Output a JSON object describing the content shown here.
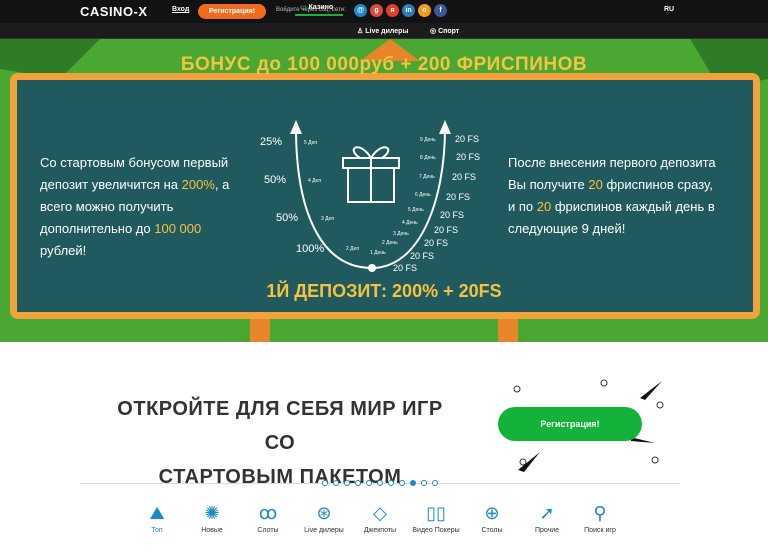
{
  "header": {
    "logo": "CASINO-X",
    "login": "Вход",
    "register": "Регистрация!",
    "social_label": "Войдите через соц. сети:",
    "social_icons": [
      "mail-ru-icon",
      "google-plus-icon",
      "odnoklassniki-icon",
      "linkedin-icon",
      "ok-icon",
      "facebook-icon"
    ],
    "lang": "RU"
  },
  "nav": {
    "items": [
      {
        "label": "Казино",
        "icon": "casino-icon"
      },
      {
        "label": "Live дилеры",
        "icon": "live-icon"
      },
      {
        "label": "Спорт",
        "icon": "sport-icon"
      }
    ]
  },
  "hero": {
    "title": "БОНУС до 100 000руб + 200 ФРИСПИНОВ",
    "left_parts": [
      "Со стартовым бонусом первый депозит увеличится на ",
      "200%",
      ", а всего можно получить дополнительно до ",
      "100 000",
      " рублей!"
    ],
    "right_parts": [
      "После внесения первого депозита Вы получите ",
      "20",
      " фриспинов сразу, и по ",
      "20",
      " фриспинов каждый день в следующие 9 дней!"
    ],
    "bottom_title": "1Й ДЕПОЗИТ: 200% + 20FS",
    "deposits": [
      {
        "pct": "25%",
        "label": "5 Деп"
      },
      {
        "pct": "50%",
        "label": "4 Деп"
      },
      {
        "pct": "50%",
        "label": "3 Деп"
      },
      {
        "pct": "100%",
        "label": "2 Деп"
      }
    ],
    "days": [
      {
        "label": "9 День",
        "fs": "20 FS"
      },
      {
        "label": "8 День",
        "fs": "20 FS"
      },
      {
        "label": "7 День",
        "fs": "20 FS"
      },
      {
        "label": "6 День",
        "fs": "20 FS"
      },
      {
        "label": "5 День",
        "fs": "20 FS"
      },
      {
        "label": "4 День",
        "fs": "20 FS"
      },
      {
        "label": "3 День",
        "fs": "20 FS"
      },
      {
        "label": "2 День",
        "fs": "20 FS"
      },
      {
        "label": "1 День",
        "fs": "20 FS"
      },
      {
        "label": "",
        "fs": "20 FS"
      }
    ]
  },
  "promo": {
    "line1": "ОТКРОЙТЕ ДЛЯ СЕБЯ МИР ИГР СО",
    "line2": "СТАРТОВЫМ ПАКЕТОМ БОНУСОВ!",
    "button": "Регистрация!",
    "active_slide": 8,
    "slides_total": 11
  },
  "categories": [
    {
      "label": "Топ",
      "icon": "mountain-icon",
      "active": true
    },
    {
      "label": "Новые",
      "icon": "sun-icon",
      "active": false
    },
    {
      "label": "Слоты",
      "icon": "cherries-icon",
      "active": false
    },
    {
      "label": "Live дилеры",
      "icon": "chips-icon",
      "active": false
    },
    {
      "label": "Джекпоты",
      "icon": "diamond-icon",
      "active": false
    },
    {
      "label": "Видео Покеры",
      "icon": "cards-icon",
      "active": false
    },
    {
      "label": "Столы",
      "icon": "roulette-icon",
      "active": false
    },
    {
      "label": "Прочие",
      "icon": "arrow-icon",
      "active": false
    },
    {
      "label": "Поиск игр",
      "icon": "search-icon",
      "active": false
    }
  ],
  "colors": {
    "green": "#13b23a",
    "orange": "#f26b1d",
    "yellow": "#f5c342",
    "blue": "#1f89c7"
  }
}
